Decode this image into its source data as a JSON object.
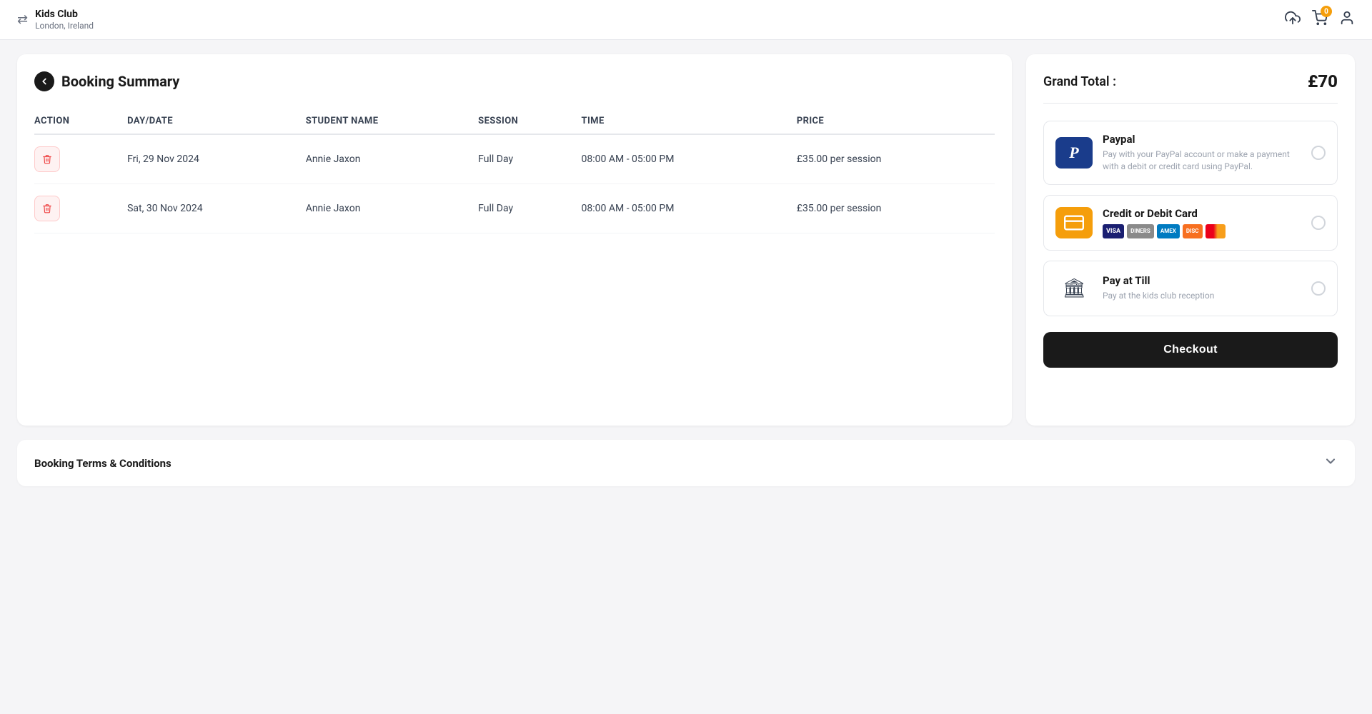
{
  "header": {
    "brand_name": "Kids Club",
    "brand_location": "London, Ireland",
    "cart_count": "0"
  },
  "booking_summary": {
    "title": "Booking Summary",
    "columns": [
      "ACTION",
      "DAY/DATE",
      "STUDENT NAME",
      "SESSION",
      "TIME",
      "PRICE"
    ],
    "rows": [
      {
        "date": "Fri, 29 Nov 2024",
        "student": "Annie Jaxon",
        "session": "Full Day",
        "time": "08:00 AM - 05:00 PM",
        "price": "£35.00 per session"
      },
      {
        "date": "Sat, 30 Nov 2024",
        "student": "Annie Jaxon",
        "session": "Full Day",
        "time": "08:00 AM - 05:00 PM",
        "price": "£35.00 per session"
      }
    ]
  },
  "payment": {
    "grand_total_label": "Grand Total :",
    "grand_total_amount": "£70",
    "options": [
      {
        "id": "paypal",
        "title": "Paypal",
        "description": "Pay with your PayPal account or make a payment with a debit or credit card using PayPal."
      },
      {
        "id": "card",
        "title": "Credit or Debit Card",
        "description": ""
      },
      {
        "id": "till",
        "title": "Pay at Till",
        "description": "Pay at the kids club reception"
      }
    ],
    "checkout_label": "Checkout"
  },
  "terms": {
    "label": "Booking Terms & Conditions"
  }
}
